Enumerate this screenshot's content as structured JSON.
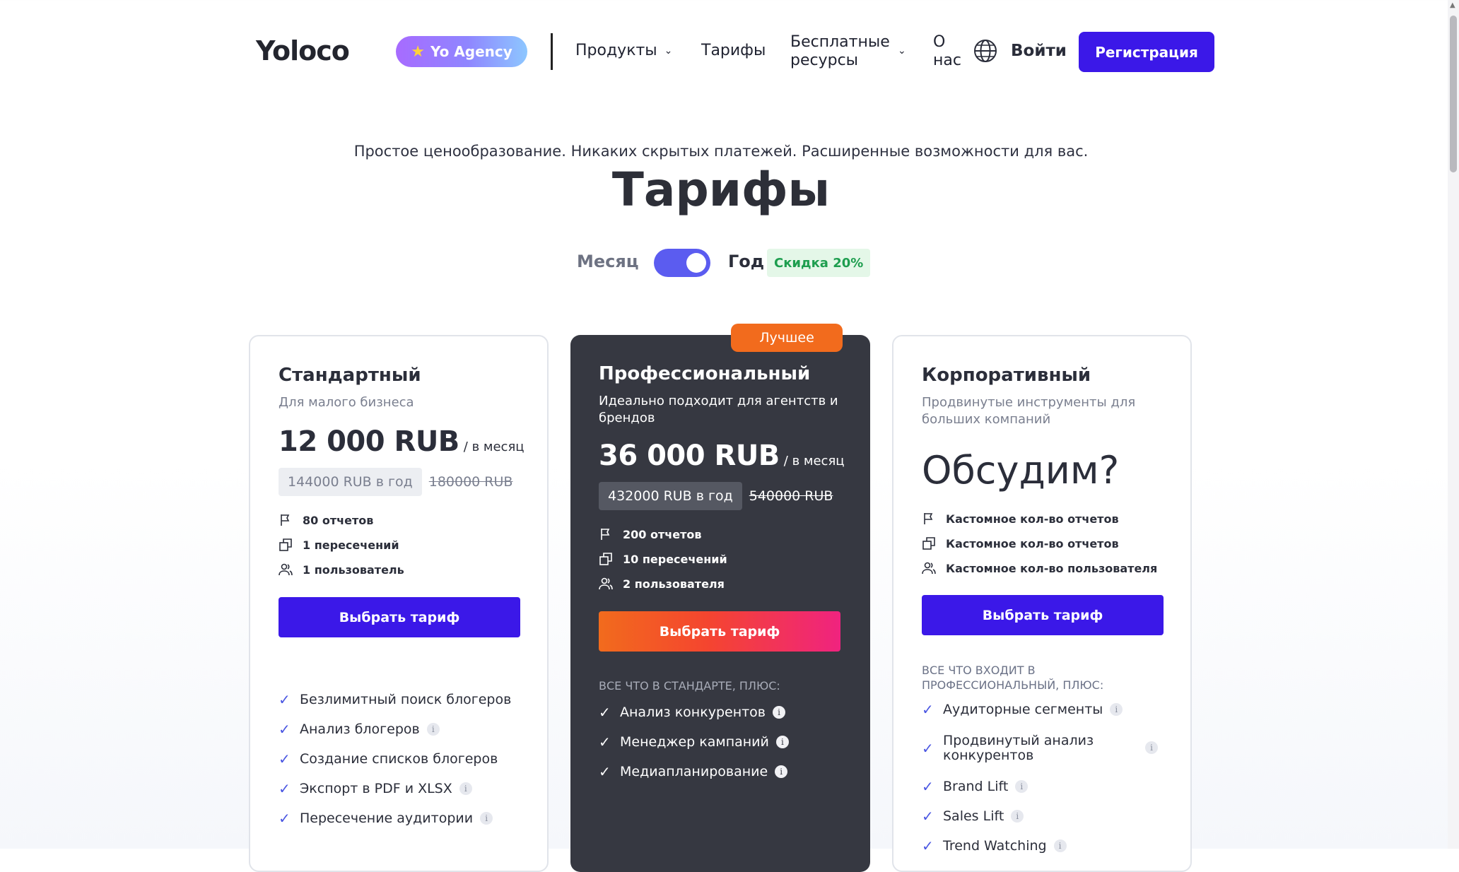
{
  "header": {
    "logo": "Yoloco",
    "agency_badge": "Yo Agency",
    "nav": [
      {
        "label": "Продукты"
      },
      {
        "label": "Тарифы"
      },
      {
        "label_line1": "Бесплатные",
        "label_line2": "ресурсы"
      },
      {
        "label_line1": "О",
        "label_line2": "нас"
      }
    ],
    "login": "Войти",
    "signup": "Регистрация"
  },
  "hero": {
    "tagline": "Простое ценообразование. Никаких скрытых платежей. Расширенные возможности для вас.",
    "title": "Тарифы",
    "toggle": {
      "month": "Месяц",
      "year": "Год",
      "discount": "Скидка 20%",
      "selected": "year"
    }
  },
  "plans": [
    {
      "name": "Стандартный",
      "subtitle": "Для малого бизнеса",
      "price": "12 000 RUB",
      "per": "/ в месяц",
      "year_price": "144000 RUB в год",
      "old_price": "180000 RUB",
      "features": [
        "80 отчетов",
        "1 пересечений",
        "1 пользователь"
      ],
      "button": "Выбрать тариф",
      "bullets": [
        "Безлимитный поиск блогеров",
        "Анализ блогеров",
        "Создание списков блогеров",
        "Экспорт в PDF и XLSX",
        "Пересечение аудитории"
      ]
    },
    {
      "name": "Профессиональный",
      "badge": "Лучшее",
      "subtitle_line1": "Идеально подходит для агентств и",
      "subtitle_line2": "брендов",
      "price": "36 000 RUB",
      "per": "/ в месяц",
      "year_price": "432000 RUB в год",
      "old_price": "540000 RUB",
      "features": [
        "200 отчетов",
        "10 пересечений",
        "2 пользователя"
      ],
      "button": "Выбрать тариф",
      "includes": "ВСЕ ЧТО В СТАНДАРТЕ, ПЛЮС:",
      "bullets": [
        "Анализ конкурентов",
        "Менеджер кампаний",
        "Медиапланирование"
      ]
    },
    {
      "name": "Корпоративный",
      "subtitle_line1": "Продвинутые инструменты для",
      "subtitle_line2": "больших компаний",
      "price": "Обсудим?",
      "features": [
        "Кастомное кол-во отчетов",
        "Кастомное кол-во отчетов",
        "Кастомное кол-во пользователя"
      ],
      "button": "Выбрать тариф",
      "includes_line1": "ВСЕ ЧТО ВХОДИТ В",
      "includes_line2": "ПРОФЕССИОНАЛЬНЫЙ, ПЛЮС:",
      "bullets": [
        "Аудиторные сегменты",
        "Продвинутый анализ",
        "конкурентов",
        "Brand Lift",
        "Sales Lift",
        "Trend Watching"
      ]
    }
  ],
  "colors": {
    "primary": "#3b18e8",
    "dark_card": "#363841",
    "accent_orange": "#f26b1d",
    "gradient_pink": "#f0237f"
  }
}
